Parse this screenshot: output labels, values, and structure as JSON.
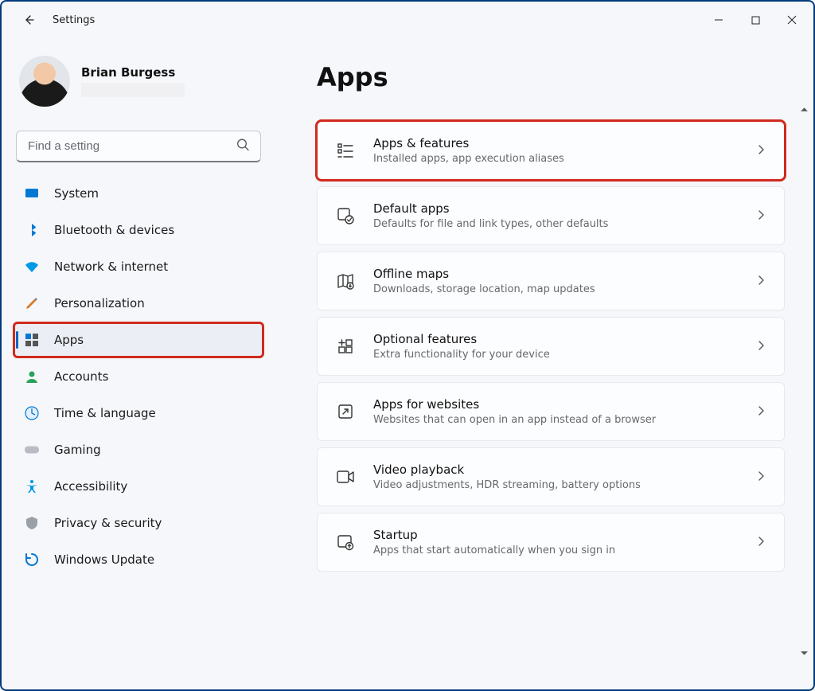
{
  "window": {
    "title": "Settings"
  },
  "profile": {
    "name": "Brian Burgess"
  },
  "search": {
    "placeholder": "Find a setting"
  },
  "sidebar": {
    "items": [
      {
        "key": "system",
        "label": "System"
      },
      {
        "key": "bluetooth",
        "label": "Bluetooth & devices"
      },
      {
        "key": "network",
        "label": "Network & internet"
      },
      {
        "key": "personalization",
        "label": "Personalization"
      },
      {
        "key": "apps",
        "label": "Apps",
        "selected": true,
        "highlight": true
      },
      {
        "key": "accounts",
        "label": "Accounts"
      },
      {
        "key": "time",
        "label": "Time & language"
      },
      {
        "key": "gaming",
        "label": "Gaming"
      },
      {
        "key": "accessibility",
        "label": "Accessibility"
      },
      {
        "key": "privacy",
        "label": "Privacy & security"
      },
      {
        "key": "update",
        "label": "Windows Update"
      }
    ]
  },
  "page": {
    "heading": "Apps",
    "cards": [
      {
        "key": "apps-features",
        "title": "Apps & features",
        "subtitle": "Installed apps, app execution aliases",
        "highlight": true
      },
      {
        "key": "default-apps",
        "title": "Default apps",
        "subtitle": "Defaults for file and link types, other defaults"
      },
      {
        "key": "offline-maps",
        "title": "Offline maps",
        "subtitle": "Downloads, storage location, map updates"
      },
      {
        "key": "optional-features",
        "title": "Optional features",
        "subtitle": "Extra functionality for your device"
      },
      {
        "key": "apps-websites",
        "title": "Apps for websites",
        "subtitle": "Websites that can open in an app instead of a browser"
      },
      {
        "key": "video-playback",
        "title": "Video playback",
        "subtitle": "Video adjustments, HDR streaming, battery options"
      },
      {
        "key": "startup",
        "title": "Startup",
        "subtitle": "Apps that start automatically when you sign in"
      }
    ]
  }
}
